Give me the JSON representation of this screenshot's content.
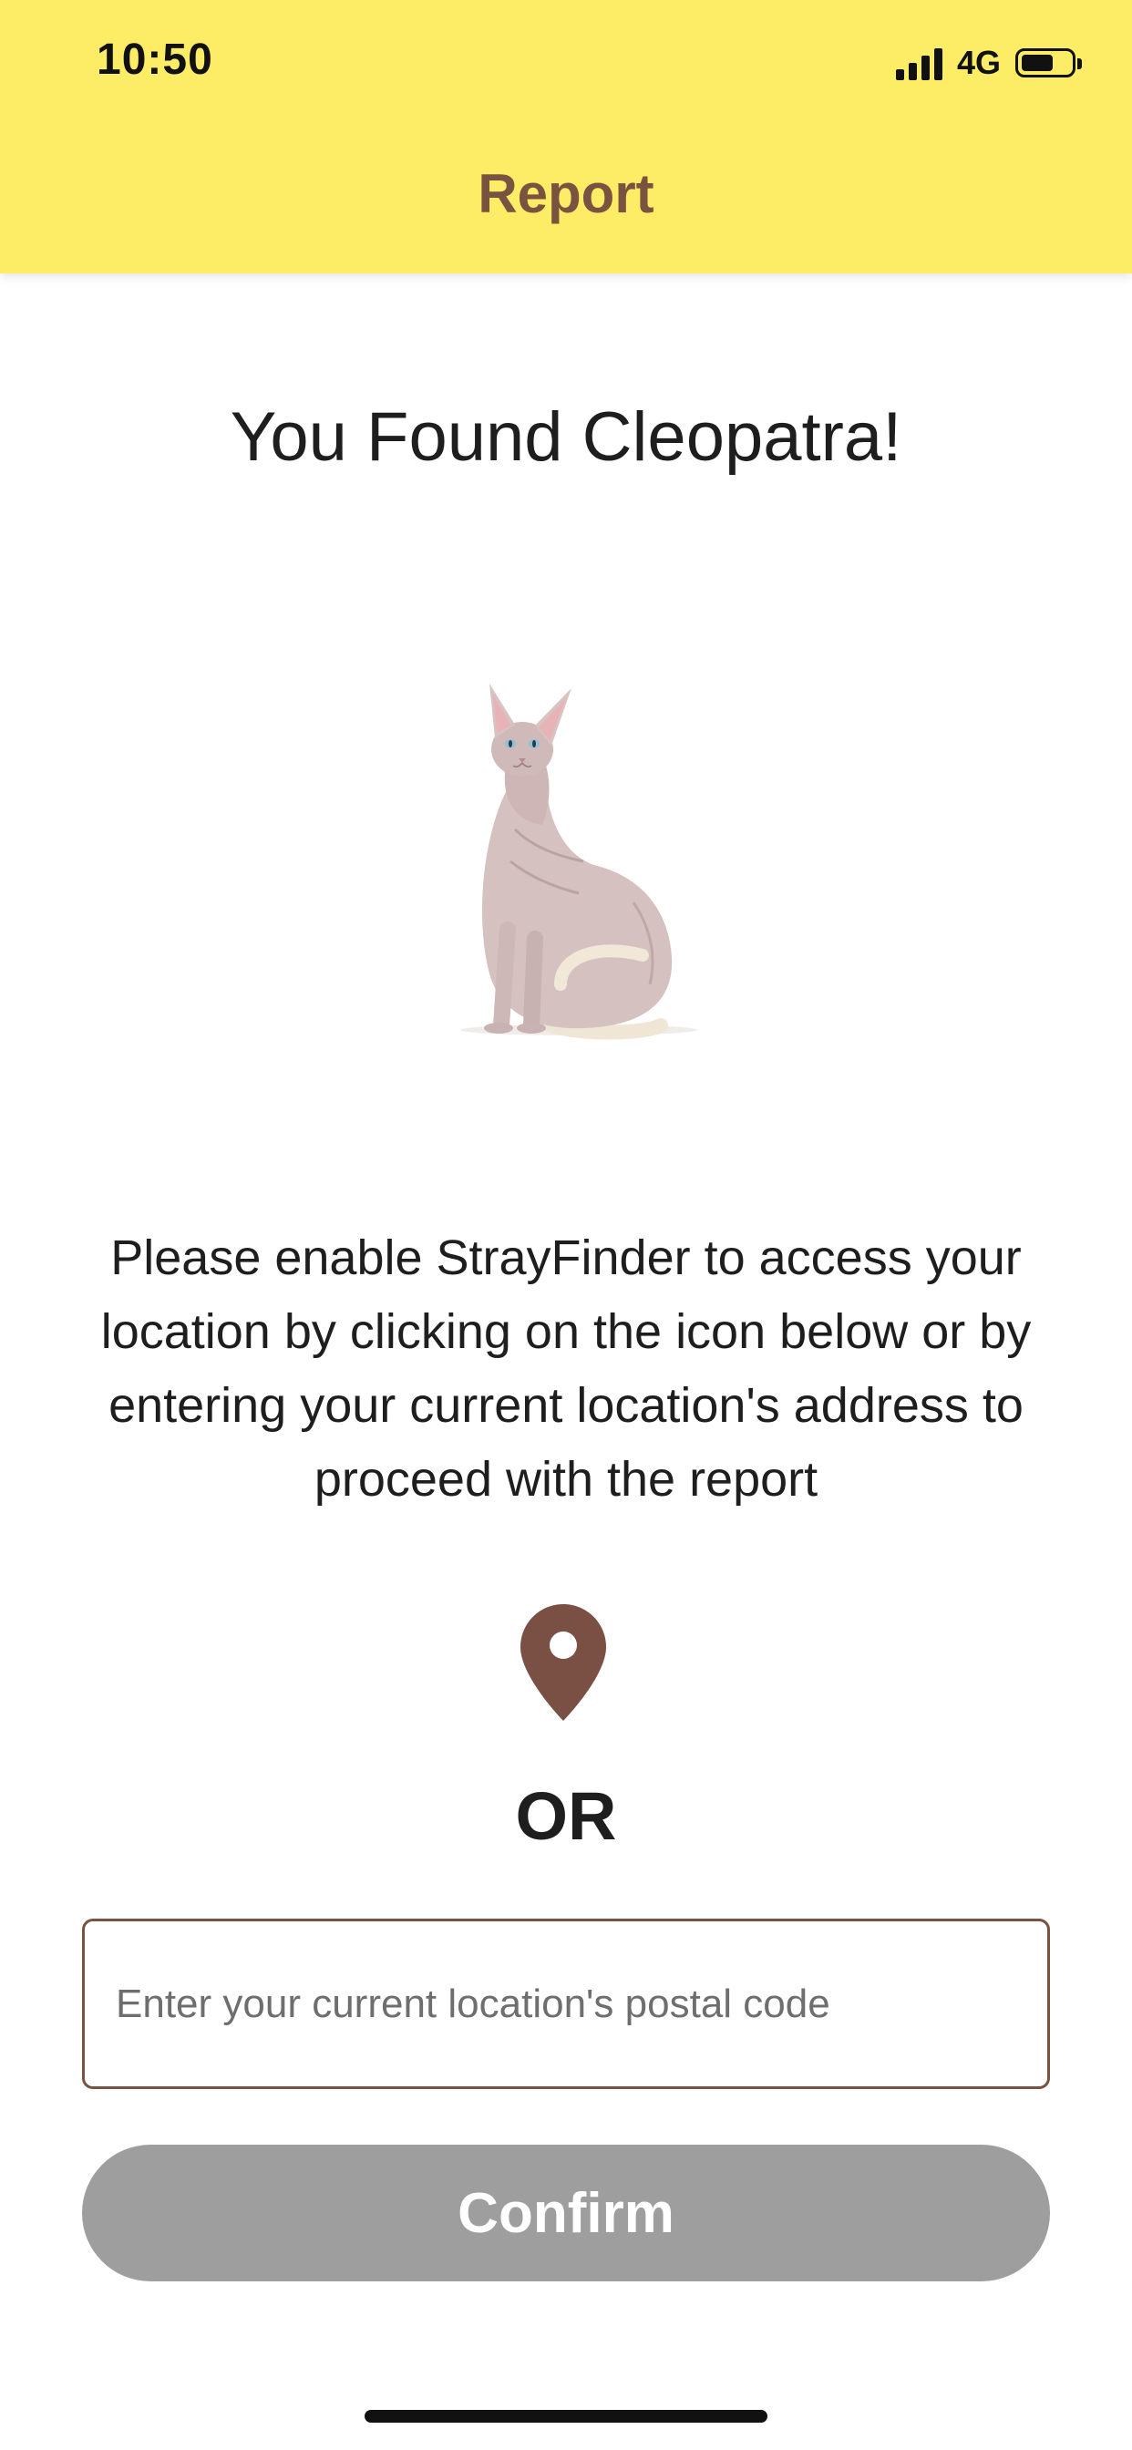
{
  "status_bar": {
    "time": "10:50",
    "network": "4G",
    "icons": [
      "cellular-signal-icon",
      "battery-icon"
    ]
  },
  "header": {
    "title": "Report"
  },
  "main": {
    "heading": "You Found Cleopatra!",
    "image": "sphynx-cat-photo",
    "instructions": "Please enable StrayFinder to access your location by clicking on the icon below or by entering your current location's address to proceed with the report",
    "location_icon": "map-pin-icon",
    "or_label": "OR",
    "postal_input": {
      "placeholder": "Enter your current location's postal code",
      "value": ""
    },
    "confirm_label": "Confirm"
  },
  "colors": {
    "header_background": "#FCEC66",
    "accent_brown": "#7A5240",
    "pin_brown": "#7A5045",
    "button_disabled": "#9E9E9E"
  }
}
